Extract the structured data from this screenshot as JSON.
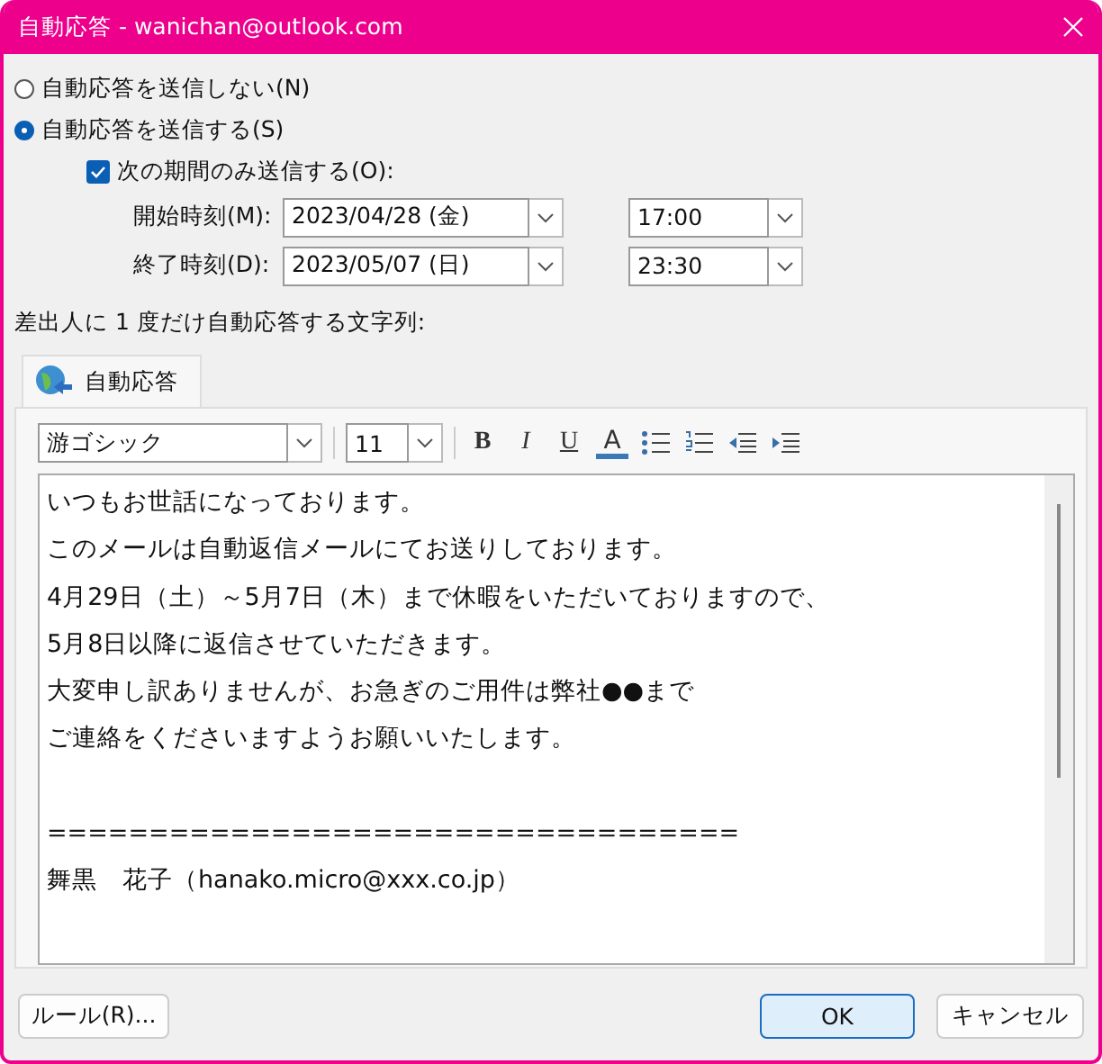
{
  "window": {
    "title": "自動応答 - wanichan@outlook.com"
  },
  "options": [
    {
      "label": "自動応答を送信しない(N)",
      "selected": false
    },
    {
      "label": "自動応答を送信する(S)",
      "selected": true
    }
  ],
  "period": {
    "label": "次の期間のみ送信する(O):",
    "checked": true,
    "rows": [
      {
        "label": "開始時刻(M):",
        "date": "2023/04/28 (金)",
        "time": "17:00"
      },
      {
        "label": "終了時刻(D):",
        "date": "2023/05/07 (日)",
        "time": "23:30"
      }
    ]
  },
  "message_label": "差出人に 1 度だけ自動応答する文字列:",
  "tabs": [
    {
      "label": "自動応答",
      "selected": true
    }
  ],
  "toolbar": {
    "font": "游ゴシック",
    "size": "11",
    "buttons": [
      {
        "kind": "bold",
        "label": "B"
      },
      {
        "kind": "italic",
        "label": "I"
      },
      {
        "kind": "underline",
        "label": "U"
      },
      {
        "kind": "color",
        "label": "A"
      },
      {
        "kind": "bullets"
      },
      {
        "kind": "numbering"
      },
      {
        "kind": "outdent"
      },
      {
        "kind": "indent"
      }
    ]
  },
  "message_paragraphs": [
    [
      "いつもお世話になっております。",
      "このメールは自動返信メールにてお送りしております。",
      "4月29日（土）～5月7日（木）まで休暇をいただいておりますので、",
      "5月8日以降に返信させていただきます。",
      "大変申し訳ありませんが、お急ぎのご用件は弊社●●まで",
      "ご連絡をくださいますようお願いいたします。"
    ],
    [
      "==================================",
      "舞黒　花子（hanako.micro@xxx.co.jp）"
    ]
  ],
  "buttons": [
    {
      "label": "ルール(R)...",
      "kind": "rules"
    },
    {
      "label": "OK",
      "kind": "ok"
    },
    {
      "label": "キャンセル",
      "kind": "cancel"
    }
  ]
}
